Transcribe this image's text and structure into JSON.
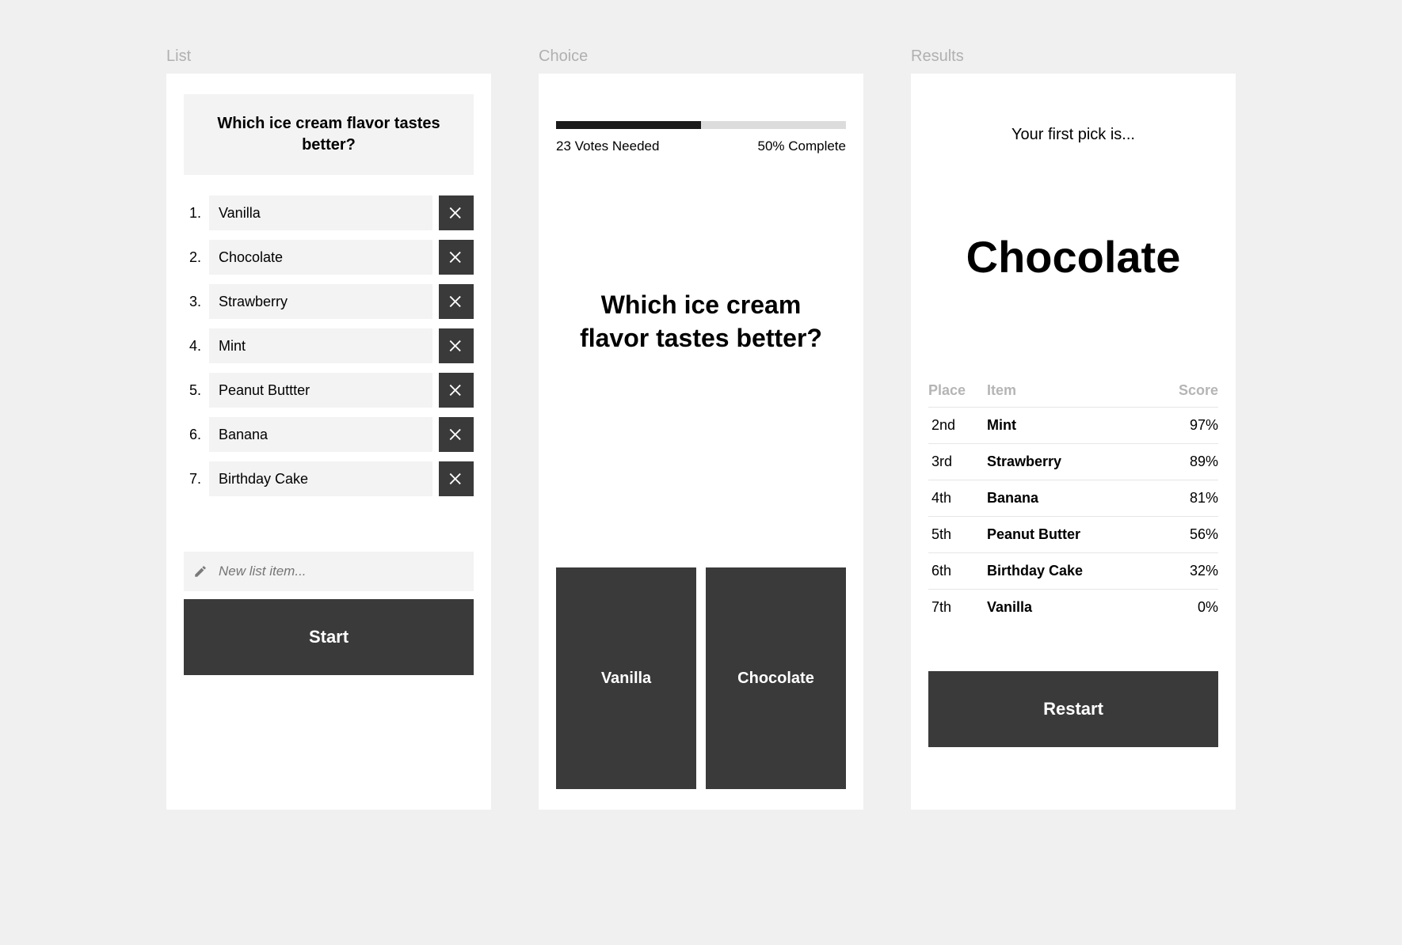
{
  "labels": {
    "list": "List",
    "choice": "Choice",
    "results": "Results"
  },
  "list": {
    "question": "Which ice cream flavor tastes better?",
    "items": [
      {
        "num": "1.",
        "name": "Vanilla"
      },
      {
        "num": "2.",
        "name": "Chocolate"
      },
      {
        "num": "3.",
        "name": "Strawberry"
      },
      {
        "num": "4.",
        "name": "Mint"
      },
      {
        "num": "5.",
        "name": "Peanut Buttter"
      },
      {
        "num": "6.",
        "name": "Banana"
      },
      {
        "num": "7.",
        "name": "Birthday Cake"
      }
    ],
    "new_item_placeholder": "New list item...",
    "start_label": "Start"
  },
  "choice": {
    "votes_needed": "23 Votes Needed",
    "percent_complete_label": "50% Complete",
    "progress_percent": 50,
    "question": "Which ice cream flavor tastes better?",
    "option_a": "Vanilla",
    "option_b": "Chocolate"
  },
  "results": {
    "first_pick_label": "Your first pick is...",
    "winner": "Chocolate",
    "columns": {
      "place": "Place",
      "item": "Item",
      "score": "Score"
    },
    "rows": [
      {
        "place": "2nd",
        "item": "Mint",
        "score": "97%"
      },
      {
        "place": "3rd",
        "item": "Strawberry",
        "score": "89%"
      },
      {
        "place": "4th",
        "item": "Banana",
        "score": "81%"
      },
      {
        "place": "5th",
        "item": "Peanut Butter",
        "score": "56%"
      },
      {
        "place": "6th",
        "item": "Birthday Cake",
        "score": "32%"
      },
      {
        "place": "7th",
        "item": "Vanilla",
        "score": "0%"
      }
    ],
    "restart_label": "Restart"
  }
}
